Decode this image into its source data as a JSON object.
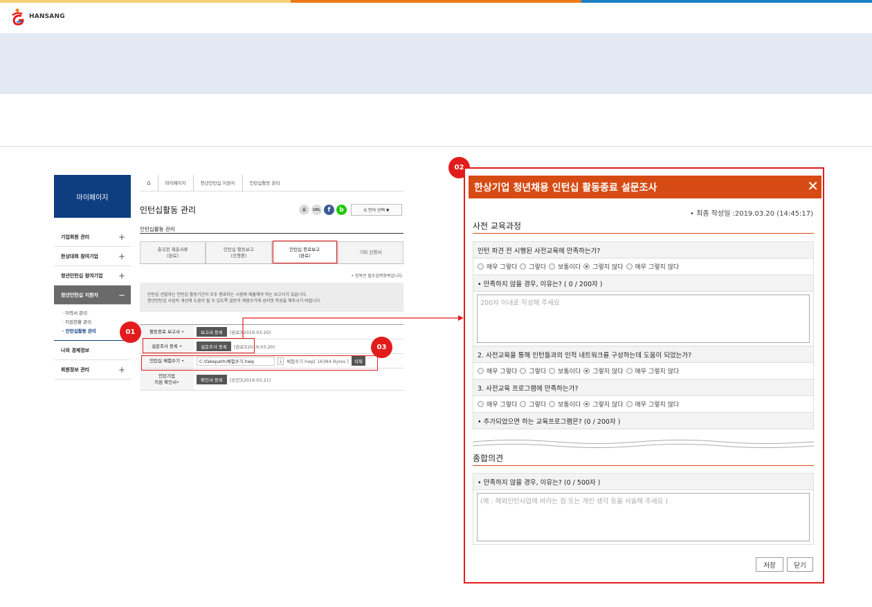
{
  "brand": {
    "name": "HANSANG",
    "stripe_colors": [
      "#f5cf73",
      "#ec7a16",
      "#1a7fc4"
    ]
  },
  "sidebar": {
    "header": "마이페이지",
    "items": [
      {
        "label": "기업회원 관리",
        "toggle": "+"
      },
      {
        "label": "한상대회 참여기업",
        "toggle": "+"
      },
      {
        "label": "청년인턴십 참여기업",
        "toggle": "+"
      },
      {
        "label": "청년인턴십 지원자",
        "toggle": "−"
      }
    ],
    "subitems": [
      "· 이력서 관리",
      "· 지원현황 관리",
      "· 인턴십활동 관리"
    ],
    "bottom_items": [
      {
        "label": "나의 경제정보",
        "toggle": ""
      },
      {
        "label": "회원정보 관리",
        "toggle": "+"
      }
    ]
  },
  "breadcrumb": {
    "home_icon": "home-icon",
    "items": [
      "마이페이지",
      "청년인턴십 지원자",
      "인턴십활동 관리"
    ]
  },
  "page": {
    "title": "인턴십활동 관리",
    "subtitle": "인턴십활동 관리",
    "icons": [
      "print-icon",
      "url-icon",
      "facebook-icon",
      "blog-icon"
    ],
    "url_label": "URL",
    "fb_label": "f",
    "blog_label": "b",
    "lang_label": "G 언어 선택 ▼",
    "tabs": [
      {
        "line1": "출국전 제출서류",
        "line2": "(완료)"
      },
      {
        "line1": "인턴십 활동보고",
        "line2": "(진행중)"
      },
      {
        "line1": "인턴십 종료보고",
        "line2": "(완료)"
      },
      {
        "line1": "기타 신청서",
        "line2": ""
      }
    ],
    "required_note": "• 항목은 필수입력항목입니다.",
    "notice_line1": "인턴십 선발자는 인턴십 활동기간이 모두 종료되는 시점에 제출해야 하는 보고서가 있습니다.",
    "notice_line2": "청년인턴십 사업의 개선에 도움이 될 수 있도록 설문과 체험수기에 성의껏 작성을 해주시기 바랍니다."
  },
  "form_rows": [
    {
      "label": "활동종료 보고서 •",
      "button": "보고서 등록",
      "status": "[완료](2019.03.20)"
    },
    {
      "label": "설문조사 등록 •",
      "button": "설문조사 등록",
      "status": "[완료](2019.03.20)"
    },
    {
      "label": "인턴십 체험수기 •",
      "file_path": "C:\\fakepath\\체험수기.hwp",
      "file_name": "체험수기.hwp[ 16384 Bytes ]",
      "delete_label": "삭제"
    },
    {
      "label_line1": "인턴기업",
      "label_line2": "지원 확인서•",
      "button": "확인서 등록",
      "status": "[승인](2019.03.21)"
    }
  ],
  "badges": [
    "01",
    "02",
    "03"
  ],
  "popup": {
    "title": "한상기업 청년채용 인턴십 활동종료 설문조사",
    "close_icon": "close-icon",
    "last_written": "• 최종 작성일 :2019.03.20 (14:45:17)",
    "section1": "사전 교육과정",
    "q1": "인턴 파견 전 시행된 사전교육에 만족하는가?",
    "options": [
      "매우 그렇다",
      "그렇다",
      "보통이다",
      "그렇지 않다",
      "매우 그렇지 않다"
    ],
    "selected_index": 3,
    "q1_reason": "• 만족하지 않을 경우, 이유는? ( 0 / 200자 )",
    "q1_placeholder": "200자 이내로 작성해 주세요",
    "q2": "2. 사전교육을 통해 인턴들과의 인적 네트워크를 구성하는데 도움이 되었는가?",
    "q3": "3. 사전교육 프로그램에 만족하는가?",
    "q3_extra": "• 추가되었으면 하는 교육프로그램은? (0 / 200자 )",
    "section2": "종합의견",
    "q4": "• 만족하지 않을 경우, 이유는? (0 / 500자 )",
    "q4_placeholder": "(예 : 해외인턴사업에 바라는 점 또는 개인 생각 등을 서술해 주세요 )",
    "save_label": "저장",
    "close_label": "닫기"
  }
}
